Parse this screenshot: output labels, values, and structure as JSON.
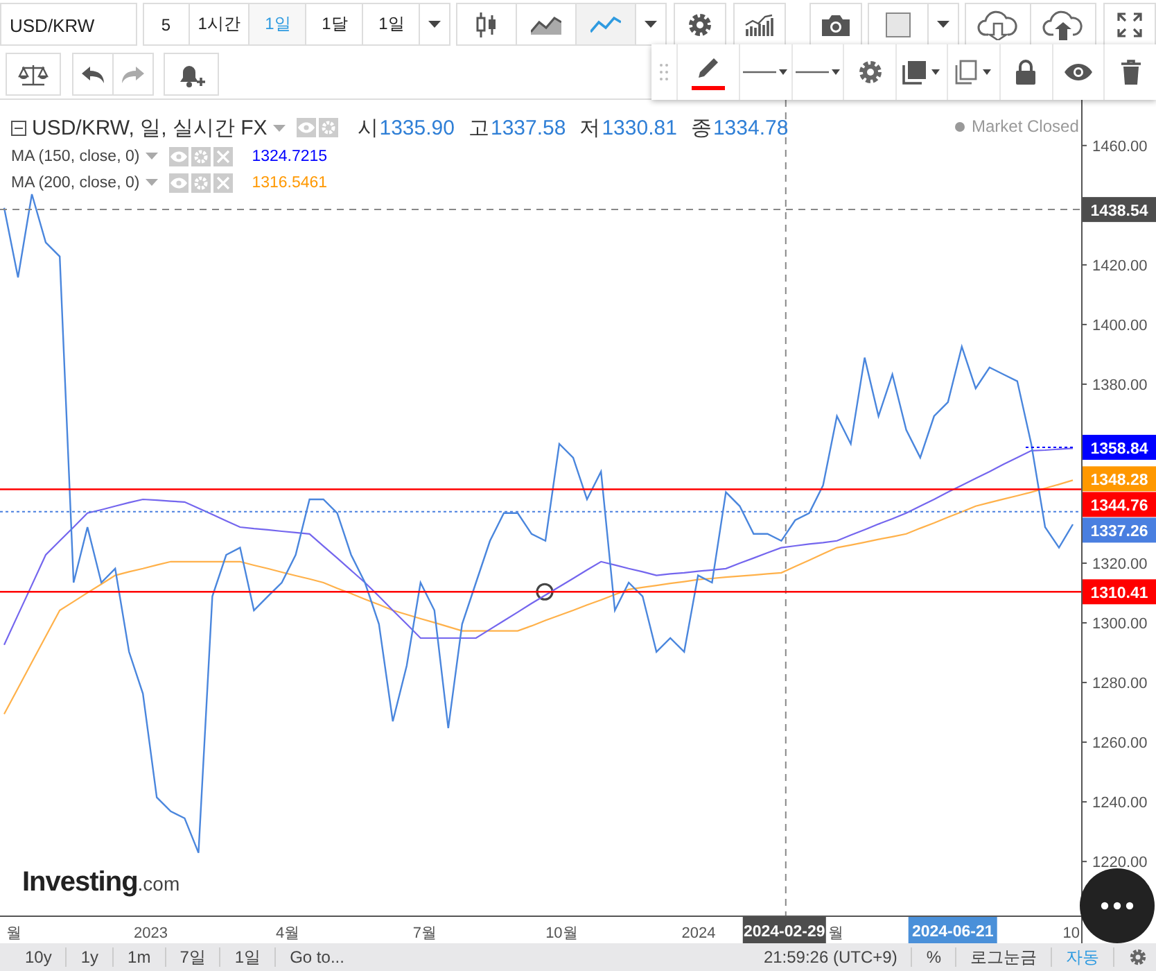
{
  "toolbar": {
    "symbol": "USD/KRW",
    "intervals": [
      {
        "label": "5",
        "selected": false
      },
      {
        "label": "1시간",
        "selected": false
      },
      {
        "label": "1일",
        "selected": true
      },
      {
        "label": "1달",
        "selected": false
      },
      {
        "label": "1일",
        "selected": false
      }
    ],
    "chart_types": [
      {
        "kind": "candles",
        "selected": false
      },
      {
        "kind": "area",
        "selected": false
      },
      {
        "kind": "line",
        "selected": true
      }
    ]
  },
  "drawing_toolbar": {
    "color": "#ff0000"
  },
  "legend": {
    "title": "USD/KRW, 일, 실시간 FX",
    "ohlc": [
      {
        "label": "시",
        "value": "1335.90"
      },
      {
        "label": "고",
        "value": "1337.58"
      },
      {
        "label": "저",
        "value": "1330.81"
      },
      {
        "label": "종",
        "value": "1334.78"
      }
    ],
    "market_status": "Market Closed",
    "indicators": [
      {
        "value": "1324.7215",
        "color": "#0000ff"
      },
      {
        "value": "1316.5461",
        "color": "#ff9800"
      }
    ]
  },
  "x_axis": {
    "labels": [
      "월",
      "2023",
      "4월",
      "7월",
      "10월",
      "2024",
      "월",
      "10"
    ]
  },
  "chart_data": {
    "type": "line",
    "ylim": [
      1201.9,
      1475.3
    ],
    "yticks": [
      {
        "value": 1220,
        "label": "1220.00"
      },
      {
        "value": 1240,
        "label": "1240.00"
      },
      {
        "value": 1260,
        "label": "1260.00"
      },
      {
        "value": 1280,
        "label": "1280.00"
      },
      {
        "value": 1300,
        "label": "1300.00"
      },
      {
        "value": 1320,
        "label": "1320.00"
      },
      {
        "value": 1380,
        "label": "1380.00"
      },
      {
        "value": 1400,
        "label": "1400.00"
      },
      {
        "value": 1420,
        "label": "1420.00"
      },
      {
        "value": 1460,
        "label": "1460.00"
      }
    ],
    "categories": [
      null,
      null,
      null,
      null,
      null,
      null,
      null,
      null,
      null,
      null,
      null,
      null,
      null,
      null,
      null,
      null,
      null,
      null,
      null,
      null,
      null,
      null,
      null,
      null,
      null,
      null,
      null,
      null,
      null,
      null,
      null,
      null,
      null,
      null,
      null,
      null,
      null,
      null,
      null,
      null,
      null,
      null,
      null,
      null,
      null,
      null,
      null,
      null,
      null,
      null,
      null,
      null,
      null,
      null,
      null,
      null,
      null,
      null,
      null,
      null,
      null,
      null,
      null,
      null,
      null,
      null,
      null,
      null,
      null,
      null,
      null,
      null,
      null,
      null,
      null,
      null,
      null,
      null
    ],
    "series": [
      {
        "color": "#4a86dd",
        "values": [
          1439.1,
          1415.8,
          1443.7,
          1427.5,
          1422.8,
          1313.5,
          1332.1,
          1313.5,
          1318.2,
          1290.3,
          1276.3,
          1241.5,
          1236.8,
          1234.5,
          1222.9,
          1308.9,
          1322.8,
          1325.2,
          1304.2,
          1308.9,
          1313.5,
          1322.8,
          1341.4,
          1341.4,
          1336.8,
          1322.8,
          1313.5,
          1299.6,
          1267.0,
          1285.6,
          1313.5,
          1304.2,
          1264.7,
          1299.6,
          1313.5,
          1327.5,
          1336.8,
          1336.8,
          1329.8,
          1327.5,
          1360.0,
          1355.4,
          1341.4,
          1350.7,
          1304.2,
          1313.5,
          1308.9,
          1290.3,
          1294.9,
          1290.3,
          1315.9,
          1313.5,
          1343.8,
          1339.1,
          1329.8,
          1329.8,
          1327.5,
          1334.4,
          1336.8,
          1346.1,
          1369.3,
          1360.0,
          1388.9,
          1369.3,
          1383.3,
          1364.7,
          1355.4,
          1369.3,
          1374.0,
          1392.6,
          1378.6,
          1385.6,
          1383.3,
          1381.0,
          1360.0,
          1332.1,
          1325.2,
          1333.0
        ]
      },
      {
        "name": "MA (150, close, 0)",
        "color": "#7466ee",
        "values": [
          1292.6,
          1302.7,
          1312.7,
          1322.8,
          1327.5,
          1332.1,
          1336.8,
          1337.9,
          1339.1,
          1340.3,
          1341.4,
          1341.1,
          1340.8,
          1340.5,
          1338.4,
          1336.3,
          1334.2,
          1332.1,
          1331.6,
          1331.2,
          1330.7,
          1330.3,
          1329.8,
          1325.7,
          1321.7,
          1317.6,
          1313.5,
          1308.9,
          1304.2,
          1299.6,
          1294.9,
          1294.9,
          1294.9,
          1294.9,
          1294.9,
          1297.8,
          1300.7,
          1303.6,
          1306.5,
          1309.3,
          1312.1,
          1314.9,
          1317.7,
          1320.5,
          1319.4,
          1318.2,
          1317.1,
          1315.9,
          1316.4,
          1316.8,
          1317.3,
          1317.7,
          1318.2,
          1320.0,
          1321.7,
          1323.5,
          1325.2,
          1325.8,
          1326.4,
          1326.9,
          1327.5,
          1329.4,
          1331.2,
          1333.1,
          1334.9,
          1336.8,
          1339.1,
          1341.4,
          1343.8,
          1346.1,
          1348.4,
          1350.7,
          1353.1,
          1355.4,
          1357.7,
          1357.9,
          1358.2,
          1358.5
        ]
      },
      {
        "name": "MA (200, close, 0)",
        "color": "#ffb14a",
        "values": [
          1269.4,
          1278.1,
          1286.8,
          1295.5,
          1304.2,
          1307.1,
          1310.1,
          1313.0,
          1315.9,
          1317.1,
          1318.2,
          1319.4,
          1320.5,
          1320.5,
          1320.5,
          1320.5,
          1320.5,
          1320.5,
          1319.3,
          1318.2,
          1317.0,
          1315.8,
          1314.7,
          1313.5,
          1311.6,
          1309.8,
          1307.9,
          1306.1,
          1304.2,
          1302.8,
          1301.4,
          1300.1,
          1298.7,
          1297.3,
          1297.3,
          1297.3,
          1297.3,
          1297.3,
          1299.0,
          1300.8,
          1302.5,
          1304.2,
          1306.0,
          1307.7,
          1309.5,
          1311.2,
          1311.9,
          1312.5,
          1313.2,
          1313.8,
          1314.5,
          1314.9,
          1315.3,
          1315.7,
          1316.0,
          1316.4,
          1316.8,
          1318.9,
          1321.0,
          1323.1,
          1325.2,
          1326.1,
          1327.0,
          1328.0,
          1328.9,
          1329.8,
          1331.7,
          1333.5,
          1335.4,
          1337.2,
          1339.1,
          1340.3,
          1341.5,
          1342.6,
          1343.8,
          1345.1,
          1346.4,
          1347.8
        ]
      }
    ]
  },
  "chart_overlays": [
    {
      "kind": "crosshair",
      "date": "2024-02-29",
      "price": "1438.54",
      "color": "#4d4d4d"
    },
    {
      "kind": "average_tag",
      "price": "1358.84",
      "color": "#0000ff"
    },
    {
      "kind": "tag",
      "price": "1348.28",
      "color": "#ff9800"
    },
    {
      "kind": "hline",
      "price": "1344.76",
      "color": "#ff0000"
    },
    {
      "kind": "last_price_tag",
      "price": "1337.26",
      "color": "#4a7fe0"
    },
    {
      "kind": "hline",
      "price": "1310.41",
      "color": "#ff0000",
      "handle": true
    },
    {
      "kind": "date_tag",
      "date": "2024-06-21",
      "color": "#4a90d9"
    }
  ],
  "logo": {
    "name": "Investing",
    "suffix": ".com"
  },
  "bottom_bar": {
    "ranges": [
      "10y",
      "1y",
      "1m",
      "7일",
      "1일"
    ],
    "goto": "Go to...",
    "time": "21:59:26 (UTC+9)",
    "options": [
      {
        "label": "%",
        "selected": false
      },
      {
        "label": "로그눈금",
        "selected": false
      },
      {
        "label": "자동",
        "selected": true
      }
    ]
  }
}
